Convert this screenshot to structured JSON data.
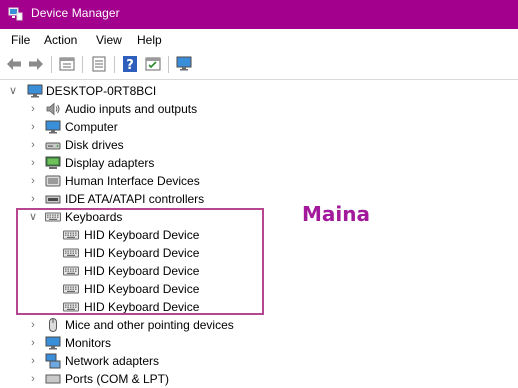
{
  "window": {
    "title": "Device Manager"
  },
  "menu": [
    "File",
    "Action",
    "View",
    "Help"
  ],
  "toolbar": {
    "buttons": [
      "back-arrow-icon",
      "forward-arrow-icon",
      "properties-icon",
      "view-list-icon",
      "help-icon",
      "show-hide-icon",
      "monitor-icon"
    ]
  },
  "tree": {
    "root": "DESKTOP-0RT8BCI",
    "categories": [
      {
        "label": "Audio inputs and outputs",
        "icon": "speaker-icon"
      },
      {
        "label": "Computer",
        "icon": "computer-icon"
      },
      {
        "label": "Disk drives",
        "icon": "disk-drive-icon"
      },
      {
        "label": "Display adapters",
        "icon": "display-adapter-icon"
      },
      {
        "label": "Human Interface Devices",
        "icon": "hid-icon"
      },
      {
        "label": "IDE ATA/ATAPI controllers",
        "icon": "ide-controller-icon"
      },
      {
        "label": "Keyboards",
        "icon": "keyboard-icon",
        "expanded": true,
        "children": [
          "HID Keyboard Device",
          "HID Keyboard Device",
          "HID Keyboard Device",
          "HID Keyboard Device",
          "HID Keyboard Device"
        ]
      },
      {
        "label": "Mice and other pointing devices",
        "icon": "mouse-icon"
      },
      {
        "label": "Monitors",
        "icon": "monitor-icon"
      },
      {
        "label": "Network adapters",
        "icon": "network-adapter-icon"
      },
      {
        "label": "Ports (COM & LPT)",
        "icon": "port-icon"
      }
    ]
  },
  "annotation": "Maina",
  "colors": {
    "titlebar": "#a2008d",
    "highlight": "#b6468f",
    "annotation": "#a3199b"
  }
}
